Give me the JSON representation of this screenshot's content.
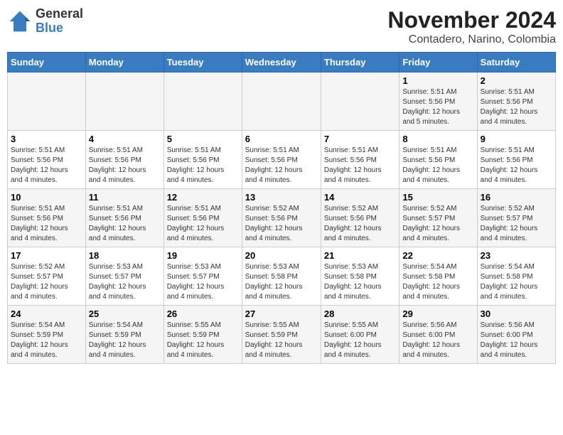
{
  "header": {
    "logo": {
      "line1": "General",
      "line2": "Blue"
    },
    "title": "November 2024",
    "subtitle": "Contadero, Narino, Colombia"
  },
  "weekdays": [
    "Sunday",
    "Monday",
    "Tuesday",
    "Wednesday",
    "Thursday",
    "Friday",
    "Saturday"
  ],
  "weeks": [
    [
      {
        "day": "",
        "info": ""
      },
      {
        "day": "",
        "info": ""
      },
      {
        "day": "",
        "info": ""
      },
      {
        "day": "",
        "info": ""
      },
      {
        "day": "",
        "info": ""
      },
      {
        "day": "1",
        "info": "Sunrise: 5:51 AM\nSunset: 5:56 PM\nDaylight: 12 hours\nand 5 minutes."
      },
      {
        "day": "2",
        "info": "Sunrise: 5:51 AM\nSunset: 5:56 PM\nDaylight: 12 hours\nand 4 minutes."
      }
    ],
    [
      {
        "day": "3",
        "info": "Sunrise: 5:51 AM\nSunset: 5:56 PM\nDaylight: 12 hours\nand 4 minutes."
      },
      {
        "day": "4",
        "info": "Sunrise: 5:51 AM\nSunset: 5:56 PM\nDaylight: 12 hours\nand 4 minutes."
      },
      {
        "day": "5",
        "info": "Sunrise: 5:51 AM\nSunset: 5:56 PM\nDaylight: 12 hours\nand 4 minutes."
      },
      {
        "day": "6",
        "info": "Sunrise: 5:51 AM\nSunset: 5:56 PM\nDaylight: 12 hours\nand 4 minutes."
      },
      {
        "day": "7",
        "info": "Sunrise: 5:51 AM\nSunset: 5:56 PM\nDaylight: 12 hours\nand 4 minutes."
      },
      {
        "day": "8",
        "info": "Sunrise: 5:51 AM\nSunset: 5:56 PM\nDaylight: 12 hours\nand 4 minutes."
      },
      {
        "day": "9",
        "info": "Sunrise: 5:51 AM\nSunset: 5:56 PM\nDaylight: 12 hours\nand 4 minutes."
      }
    ],
    [
      {
        "day": "10",
        "info": "Sunrise: 5:51 AM\nSunset: 5:56 PM\nDaylight: 12 hours\nand 4 minutes."
      },
      {
        "day": "11",
        "info": "Sunrise: 5:51 AM\nSunset: 5:56 PM\nDaylight: 12 hours\nand 4 minutes."
      },
      {
        "day": "12",
        "info": "Sunrise: 5:51 AM\nSunset: 5:56 PM\nDaylight: 12 hours\nand 4 minutes."
      },
      {
        "day": "13",
        "info": "Sunrise: 5:52 AM\nSunset: 5:56 PM\nDaylight: 12 hours\nand 4 minutes."
      },
      {
        "day": "14",
        "info": "Sunrise: 5:52 AM\nSunset: 5:56 PM\nDaylight: 12 hours\nand 4 minutes."
      },
      {
        "day": "15",
        "info": "Sunrise: 5:52 AM\nSunset: 5:57 PM\nDaylight: 12 hours\nand 4 minutes."
      },
      {
        "day": "16",
        "info": "Sunrise: 5:52 AM\nSunset: 5:57 PM\nDaylight: 12 hours\nand 4 minutes."
      }
    ],
    [
      {
        "day": "17",
        "info": "Sunrise: 5:52 AM\nSunset: 5:57 PM\nDaylight: 12 hours\nand 4 minutes."
      },
      {
        "day": "18",
        "info": "Sunrise: 5:53 AM\nSunset: 5:57 PM\nDaylight: 12 hours\nand 4 minutes."
      },
      {
        "day": "19",
        "info": "Sunrise: 5:53 AM\nSunset: 5:57 PM\nDaylight: 12 hours\nand 4 minutes."
      },
      {
        "day": "20",
        "info": "Sunrise: 5:53 AM\nSunset: 5:58 PM\nDaylight: 12 hours\nand 4 minutes."
      },
      {
        "day": "21",
        "info": "Sunrise: 5:53 AM\nSunset: 5:58 PM\nDaylight: 12 hours\nand 4 minutes."
      },
      {
        "day": "22",
        "info": "Sunrise: 5:54 AM\nSunset: 5:58 PM\nDaylight: 12 hours\nand 4 minutes."
      },
      {
        "day": "23",
        "info": "Sunrise: 5:54 AM\nSunset: 5:58 PM\nDaylight: 12 hours\nand 4 minutes."
      }
    ],
    [
      {
        "day": "24",
        "info": "Sunrise: 5:54 AM\nSunset: 5:59 PM\nDaylight: 12 hours\nand 4 minutes."
      },
      {
        "day": "25",
        "info": "Sunrise: 5:54 AM\nSunset: 5:59 PM\nDaylight: 12 hours\nand 4 minutes."
      },
      {
        "day": "26",
        "info": "Sunrise: 5:55 AM\nSunset: 5:59 PM\nDaylight: 12 hours\nand 4 minutes."
      },
      {
        "day": "27",
        "info": "Sunrise: 5:55 AM\nSunset: 5:59 PM\nDaylight: 12 hours\nand 4 minutes."
      },
      {
        "day": "28",
        "info": "Sunrise: 5:55 AM\nSunset: 6:00 PM\nDaylight: 12 hours\nand 4 minutes."
      },
      {
        "day": "29",
        "info": "Sunrise: 5:56 AM\nSunset: 6:00 PM\nDaylight: 12 hours\nand 4 minutes."
      },
      {
        "day": "30",
        "info": "Sunrise: 5:56 AM\nSunset: 6:00 PM\nDaylight: 12 hours\nand 4 minutes."
      }
    ]
  ]
}
